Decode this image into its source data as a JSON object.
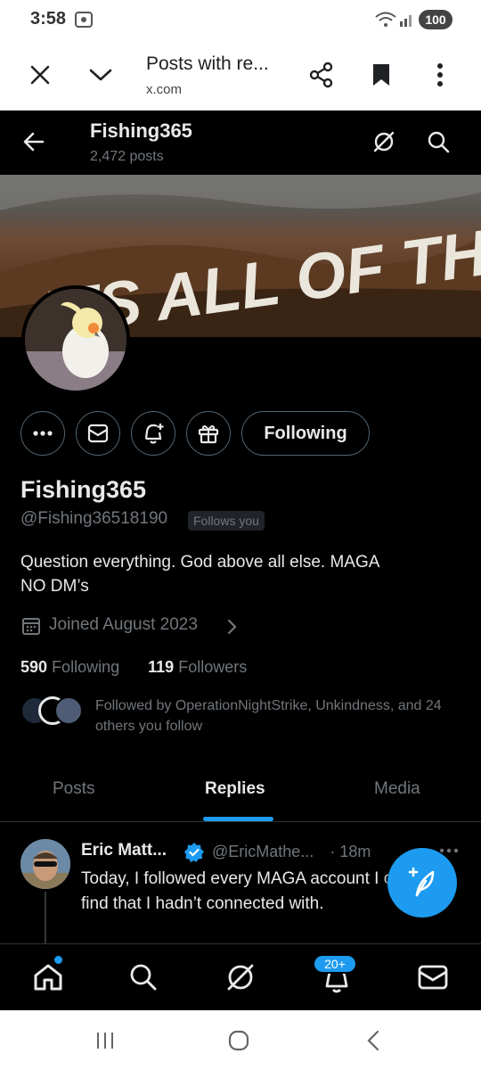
{
  "status_bar": {
    "time": "3:58",
    "battery": "100"
  },
  "browser": {
    "title": "Posts with re...",
    "url": "x.com"
  },
  "header": {
    "name": "Fishing365",
    "post_count": "2,472 posts"
  },
  "banner": {
    "text": "ITS ALL OF THEM"
  },
  "profile": {
    "follow_button": "Following",
    "display_name": "Fishing365",
    "handle": "@Fishing36518190",
    "follows_you": "Follows you",
    "bio_line1": "Question everything. God above all else.  MAGA",
    "bio_line2": "NO DM’s",
    "joined": "Joined August 2023",
    "following_count": "590",
    "following_label": "Following",
    "followers_count": "119",
    "followers_label": "Followers",
    "followed_by": "Followed by OperationNightStrike, Unkindness, and 24 others you follow"
  },
  "tabs": [
    {
      "label": "Posts"
    },
    {
      "label": "Replies"
    },
    {
      "label": "Media"
    }
  ],
  "post": {
    "name": "Eric Matt...",
    "handle": "@EricMathe...",
    "time": "· 18m",
    "text": "Today, I followed every MAGA account I could find that I hadn’t connected with."
  },
  "bottom_nav": {
    "notifications_badge": "20+"
  },
  "colors": {
    "accent": "#1d9bf0",
    "background": "#000000",
    "text": "#e7e9ea",
    "muted": "#71767b"
  }
}
